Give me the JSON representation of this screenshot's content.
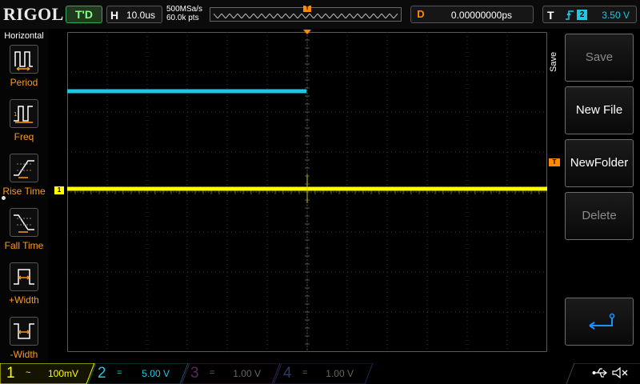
{
  "brand": "RIGOL",
  "status": "T'D",
  "horizontal": {
    "label": "H",
    "timebase": "10.0us",
    "sample_rate": "500MSa/s",
    "mem_depth": "60.0k pts"
  },
  "delay": {
    "label": "D",
    "value": "0.00000000ps"
  },
  "trigger": {
    "label": "T",
    "edge_icon": "rising-edge-icon",
    "source": "2",
    "level": "3.50 V"
  },
  "markers": {
    "trigger_pos": "T",
    "trigger_level": "T",
    "ch1_ground": "1"
  },
  "left_menu": {
    "title": "Horizontal",
    "items": [
      {
        "label": "Period",
        "icon": "period-icon"
      },
      {
        "label": "Freq",
        "icon": "frequency-icon"
      },
      {
        "label": "Rise Time",
        "icon": "rise-time-icon"
      },
      {
        "label": "Fall Time",
        "icon": "fall-time-icon"
      },
      {
        "label": "+Width",
        "icon": "positive-width-icon"
      },
      {
        "label": "-Width",
        "icon": "negative-width-icon"
      }
    ]
  },
  "right_menu": {
    "title": "Save",
    "keys": [
      {
        "label": "Save",
        "enabled": false
      },
      {
        "label": "New File",
        "enabled": true
      },
      {
        "label": "NewFolder",
        "enabled": true
      },
      {
        "label": "Delete",
        "enabled": false
      }
    ],
    "return_icon": "return-arrow-icon"
  },
  "channels": [
    {
      "num": "1",
      "coupling": "~",
      "scale": "100mV",
      "color": "#ffff00",
      "active": true
    },
    {
      "num": "2",
      "coupling": "=",
      "scale": "5.00 V",
      "color": "#1ec8e0",
      "active": true
    },
    {
      "num": "3",
      "coupling": "=",
      "scale": "1.00 V",
      "color": "#d81bd8",
      "active": false
    },
    {
      "num": "4",
      "coupling": "=",
      "scale": "1.00 V",
      "color": "#2a6bff",
      "active": false
    }
  ],
  "status_icons": [
    "usb-icon",
    "speaker-muted-icon"
  ]
}
